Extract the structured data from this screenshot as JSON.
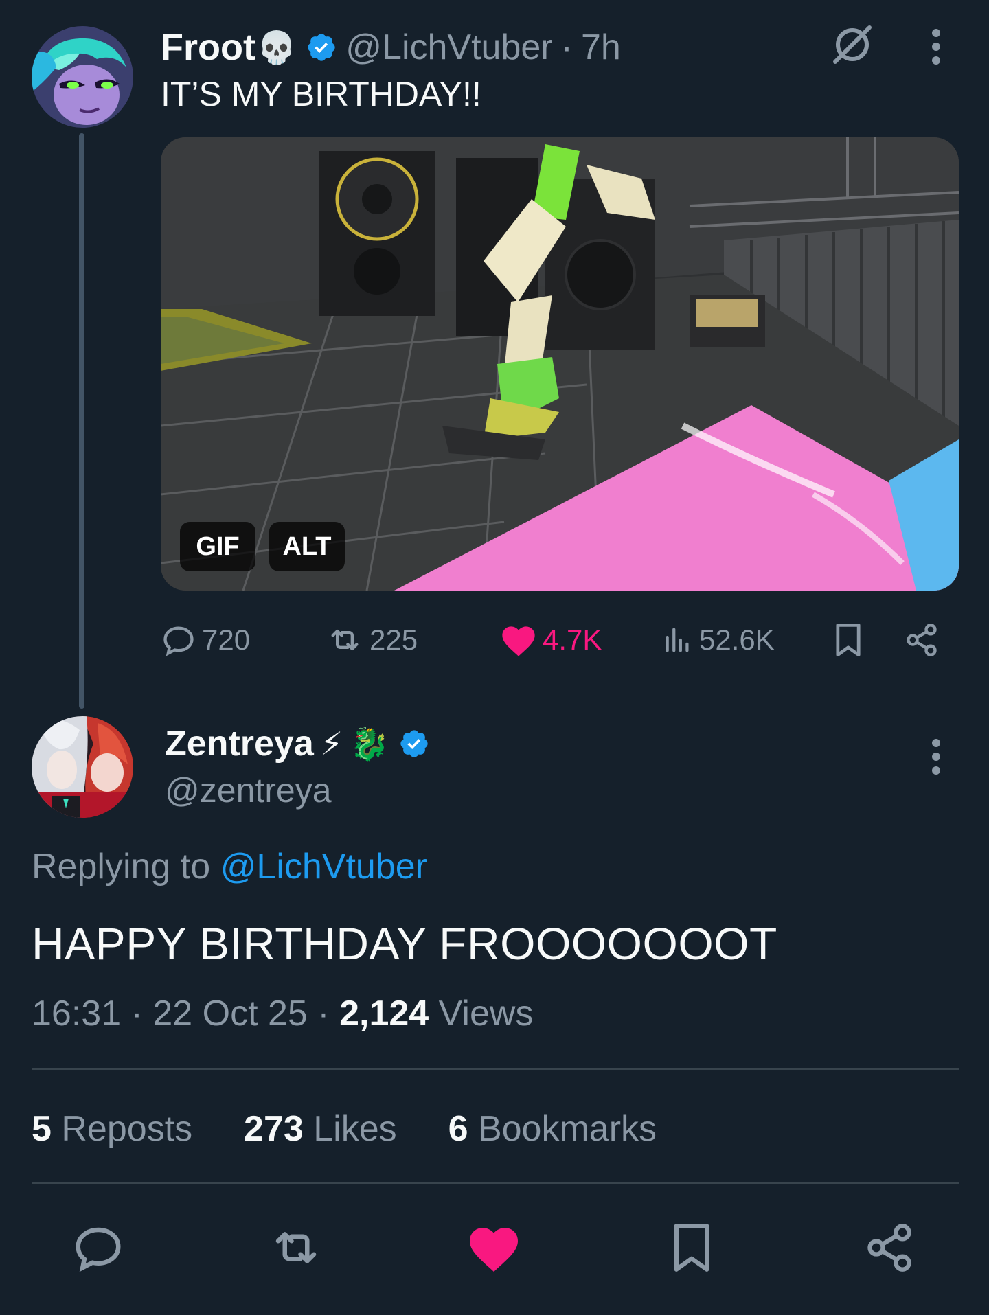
{
  "parent_tweet": {
    "display_name": "Froot",
    "name_emoji": "💀",
    "handle": "@LichVtuber",
    "separator": "·",
    "time": "7h",
    "text": "IT’S MY BIRTHDAY!!",
    "media": {
      "gif_badge": "GIF",
      "alt_badge": "ALT"
    },
    "actions": {
      "replies": "720",
      "reposts": "225",
      "likes": "4.7K",
      "views": "52.6K"
    }
  },
  "reply_tweet": {
    "display_name": "Zentreya",
    "name_emojis": [
      "⚡",
      "🐉"
    ],
    "handle": "@zentreya",
    "replying_prefix": "Replying to",
    "replying_handle": "@LichVtuber",
    "text": "HAPPY BIRTHDAY FROOOOOOOT",
    "time": "16:31",
    "date": "22 Oct 25",
    "sep": "·",
    "views_count": "2,124",
    "views_label": "Views",
    "stats": {
      "reposts_count": "5",
      "reposts_label": "Reposts",
      "likes_count": "273",
      "likes_label": "Likes",
      "bookmarks_count": "6",
      "bookmarks_label": "Bookmarks"
    }
  },
  "colors": {
    "background": "#15202b",
    "text": "#f7f9f9",
    "muted": "#8b98a5",
    "link": "#1d9bf0",
    "like": "#f91880",
    "divider": "#38444d"
  },
  "icons": {
    "verified": "verified-badge-icon",
    "grok": "grok-icon",
    "more": "more-vertical-icon",
    "reply": "reply-icon",
    "repost": "repost-icon",
    "like": "heart-icon",
    "views": "views-icon",
    "bookmark": "bookmark-icon",
    "share": "share-icon"
  }
}
